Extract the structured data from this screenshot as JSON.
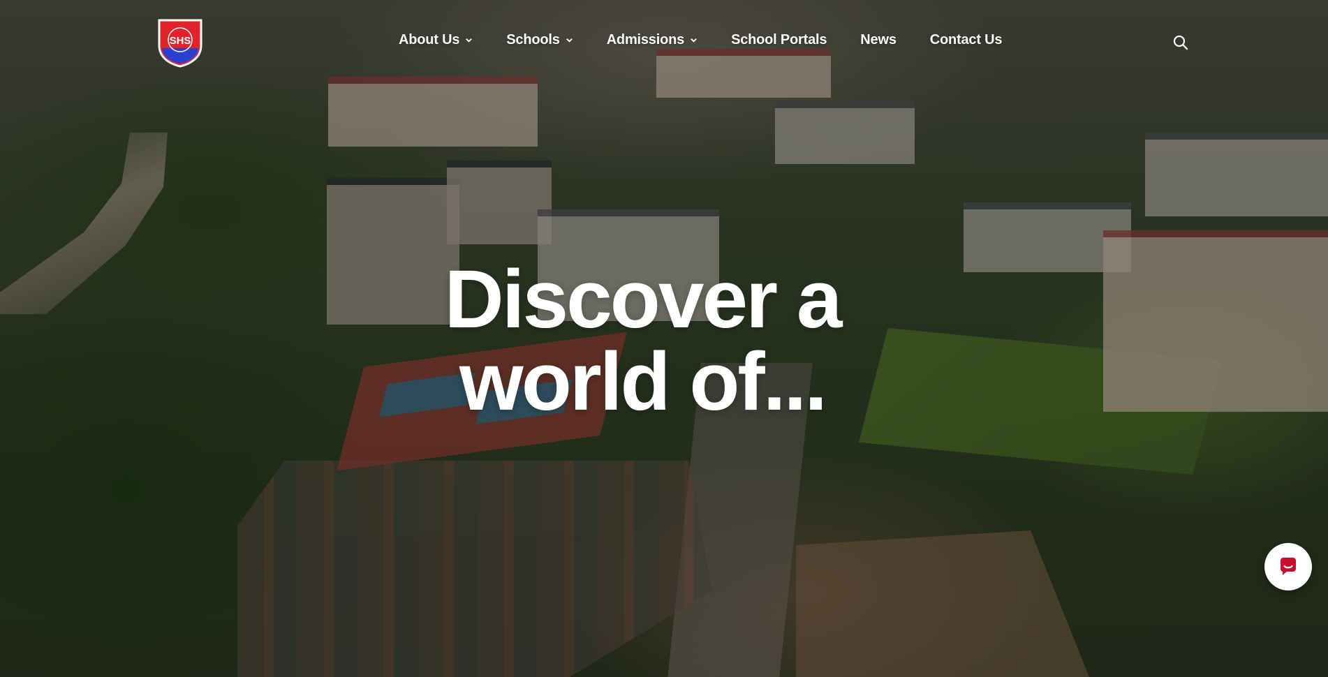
{
  "logo": {
    "initials": "SHS",
    "ring_text": "INSTRUCTIONS WIN LEARN",
    "colors": {
      "shield_red": "#e3232c",
      "shield_blue": "#2b3fd0",
      "outline": "#ffffff"
    }
  },
  "nav": {
    "items": [
      {
        "label": "About Us",
        "has_dropdown": true
      },
      {
        "label": "Schools",
        "has_dropdown": true
      },
      {
        "label": "Admissions",
        "has_dropdown": true
      },
      {
        "label": "School Portals",
        "has_dropdown": false
      },
      {
        "label": "News",
        "has_dropdown": false
      },
      {
        "label": "Contact Us",
        "has_dropdown": false
      }
    ],
    "search_icon": "search-icon"
  },
  "hero": {
    "headline_line1": "Discover a",
    "headline_line2": "world of..."
  },
  "chat": {
    "icon": "chat-bubble-icon",
    "accent": "#c8102e"
  },
  "colors": {
    "text": "#ffffff"
  }
}
